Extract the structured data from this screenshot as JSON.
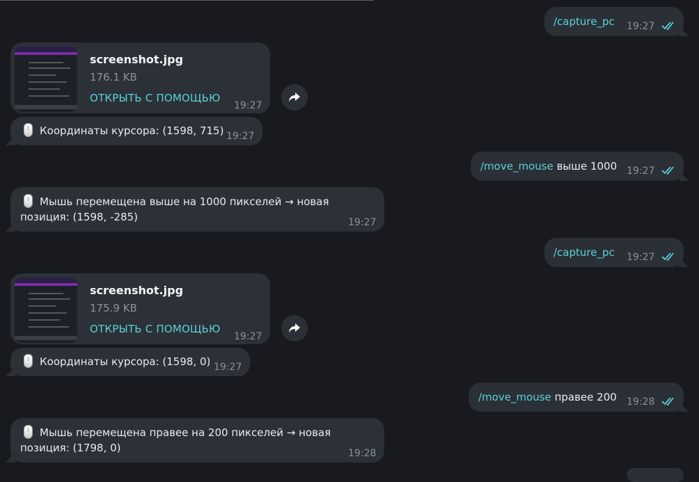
{
  "messages": [
    {
      "command": "/capture_pc",
      "args": "",
      "time": "19:27"
    },
    {
      "file_name": "screenshot.jpg",
      "file_size": "176.1 KB",
      "open_label": "ОТКРЫТЬ С ПОМОЩЬЮ",
      "time": "19:27"
    },
    {
      "text": "Координаты курсора: (1598, 715)",
      "time": "19:27"
    },
    {
      "command": "/move_mouse",
      "args": " выше 1000",
      "time": "19:27"
    },
    {
      "text_line1": "Мышь перемещена выше на 1000 пикселей → новая",
      "text_line2": "позиция: (1598, -285)",
      "time": "19:27"
    },
    {
      "command": "/capture_pc",
      "args": "",
      "time": "19:27"
    },
    {
      "file_name": "screenshot.jpg",
      "file_size": "175.9 KB",
      "open_label": "ОТКРЫТЬ С ПОМОЩЬЮ",
      "time": "19:27"
    },
    {
      "text": "Координаты курсора: (1598, 0)",
      "time": "19:27"
    },
    {
      "command": "/move_mouse",
      "args": " правее 200",
      "time": "19:28"
    },
    {
      "text_line1": "Мышь перемещена правее на 200 пикселей → новая",
      "text_line2": "позиция: (1798, 0)",
      "time": "19:28"
    }
  ],
  "icons": {
    "read": "double-check-icon",
    "forward": "forward-arrow-icon",
    "mouse": "computer-mouse-icon"
  },
  "colors": {
    "background": "#181a1f",
    "bubble": "#2c3037",
    "accent": "#5ad3d7",
    "time": "#8a939c"
  }
}
